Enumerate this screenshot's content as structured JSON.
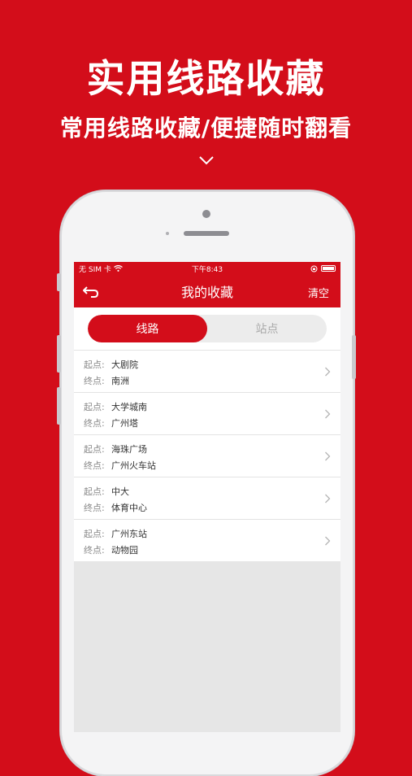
{
  "promo": {
    "headline": "实用线路收藏",
    "subline": "常用线路收藏/便捷随时翻看",
    "chevron_icon": "chevron-down-icon"
  },
  "status_bar": {
    "carrier": "无 SIM 卡",
    "time": "下午8:43"
  },
  "nav": {
    "title": "我的收藏",
    "clear_label": "清空",
    "back_icon": "back-arrow-icon"
  },
  "segments": [
    {
      "label": "线路",
      "active": true
    },
    {
      "label": "站点",
      "active": false
    }
  ],
  "labels": {
    "start": "起点:",
    "end": "终点:"
  },
  "routes": [
    {
      "start": "大剧院",
      "end": "南洲"
    },
    {
      "start": "大学城南",
      "end": "广州塔"
    },
    {
      "start": "海珠广场",
      "end": "广州火车站"
    },
    {
      "start": "中大",
      "end": "体育中心"
    },
    {
      "start": "广州东站",
      "end": "动物园"
    }
  ],
  "colors": {
    "accent": "#d30d1a",
    "page_background": "#e6e6e6"
  }
}
